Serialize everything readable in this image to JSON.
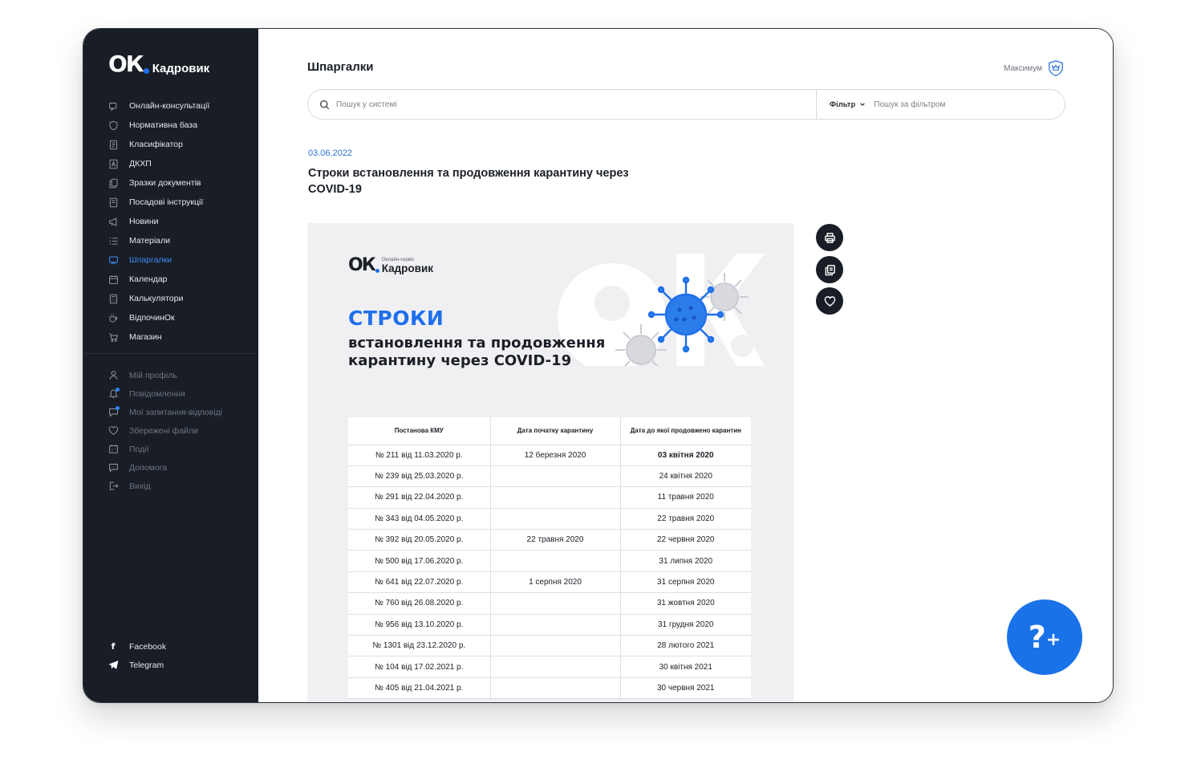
{
  "brand": {
    "logo_mark": "ОК",
    "name": "Кадровик"
  },
  "nav": [
    {
      "label": "Онлайн-консультації",
      "icon": "consult-icon"
    },
    {
      "label": "Нормативна база",
      "icon": "shield-icon"
    },
    {
      "label": "Класифікатор",
      "icon": "list-doc-icon"
    },
    {
      "label": "ДКХП",
      "icon": "letter-a-icon"
    },
    {
      "label": "Зразки документів",
      "icon": "docs-icon"
    },
    {
      "label": "Посадові інструкції",
      "icon": "instruction-icon"
    },
    {
      "label": "Новини",
      "icon": "megaphone-icon"
    },
    {
      "label": "Матеріали",
      "icon": "materials-icon"
    },
    {
      "label": "Шпаргалки",
      "icon": "cheatsheet-icon",
      "active": true
    },
    {
      "label": "Календар",
      "icon": "calendar-icon"
    },
    {
      "label": "Калькулятори",
      "icon": "calculator-icon"
    },
    {
      "label": "ВідпочинОк",
      "icon": "coffee-icon"
    },
    {
      "label": "Магазин",
      "icon": "cart-icon"
    }
  ],
  "nav2": [
    {
      "label": "Мій профіль",
      "icon": "user-icon"
    },
    {
      "label": "Повідомлення",
      "icon": "bell-icon",
      "badge": true
    },
    {
      "label": "Мої запитання-відповіді",
      "icon": "chat-icon",
      "badge": true
    },
    {
      "label": "Збережені файли",
      "icon": "heart-icon"
    },
    {
      "label": "Події",
      "icon": "events-icon"
    },
    {
      "label": "Допомога",
      "icon": "help-icon"
    },
    {
      "label": "Вихід",
      "icon": "logout-icon"
    }
  ],
  "social": [
    {
      "label": "Facebook",
      "icon": "facebook-icon"
    },
    {
      "label": "Telegram",
      "icon": "telegram-icon"
    }
  ],
  "header": {
    "title": "Шпаргалки",
    "plan": "Максимум"
  },
  "search": {
    "placeholder": "Пошук у системі",
    "filter_label": "Фільтр",
    "filter_placeholder": "Пошук за фільтром"
  },
  "article": {
    "date": "03.06.2022",
    "title": "Строки встановлення та продовження карантину через COVID-19"
  },
  "document": {
    "logo_small": "Онлайн-сервіс",
    "logo_big": "Кадровик",
    "logo_mark": "ОК",
    "heading1": "СТРОКИ",
    "heading2": "встановлення та продовження карантину через COVID-19",
    "table": {
      "headers": [
        "Постанова КМУ",
        "Дата початку карантину",
        "Дата до якої продовжено карантин"
      ],
      "rows": [
        [
          "№ 211 від 11.03.2020 р.",
          "12 березня 2020",
          "03 квітня 2020"
        ],
        [
          "№ 239 від 25.03.2020 р.",
          "",
          "24 квітня 2020"
        ],
        [
          "№ 291 від 22.04.2020 р.",
          "",
          "11 травня 2020"
        ],
        [
          "№ 343 від 04.05.2020 р.",
          "",
          "22 травня 2020"
        ],
        [
          "№ 392 від 20.05.2020 р.",
          "22 травня 2020",
          "22 червня 2020"
        ],
        [
          "№ 500 від 17.06.2020 р.",
          "",
          "31 липня 2020"
        ],
        [
          "№ 641 від 22.07.2020 р.",
          "1 серпня 2020",
          "31 серпня 2020"
        ],
        [
          "№ 760 від 26.08.2020 р.",
          "",
          "31 жовтня 2020"
        ],
        [
          "№ 956 від 13.10.2020 р.",
          "",
          "31 грудня 2020"
        ],
        [
          "№ 1301 від 23.12.2020 р.",
          "",
          "28 лютого 2021"
        ],
        [
          "№ 104 від 17.02.2021 р.",
          "",
          "30 квітня 2021"
        ],
        [
          "№ 405 від 21.04.2021 р.",
          "",
          "30 червня 2021"
        ]
      ]
    }
  },
  "actions": [
    {
      "name": "print-button",
      "icon": "printer-icon"
    },
    {
      "name": "copy-button",
      "icon": "copy-icon"
    },
    {
      "name": "favorite-button",
      "icon": "heart-icon"
    }
  ],
  "fab": {
    "q": "?",
    "plus": "+"
  },
  "colors": {
    "sidebar_bg": "#181d26",
    "accent": "#1f6feb",
    "active_nav": "#3d8bf0"
  }
}
